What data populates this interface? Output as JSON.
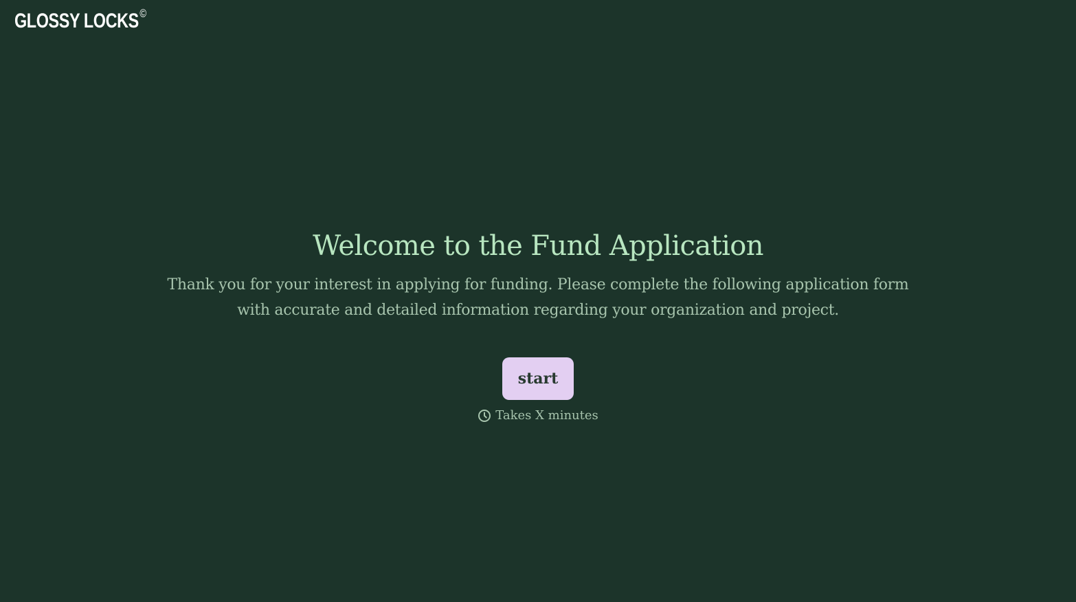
{
  "brand": {
    "name": "GLOSSY LOCKS",
    "mark": "©"
  },
  "welcome": {
    "title": "Welcome to the Fund Application",
    "description": "Thank you for your interest in applying for funding. Please complete the following application form with accurate and detailed information regarding your organization and project.",
    "start_label": "start",
    "duration_text": "Takes X minutes",
    "duration_icon": "clock-icon"
  },
  "colors": {
    "background": "#1c342a",
    "title": "#b8e6c0",
    "body_text": "#a7c4ad",
    "button_bg": "#e3cff2",
    "button_text": "#283a30",
    "logo": "#ffffff"
  }
}
